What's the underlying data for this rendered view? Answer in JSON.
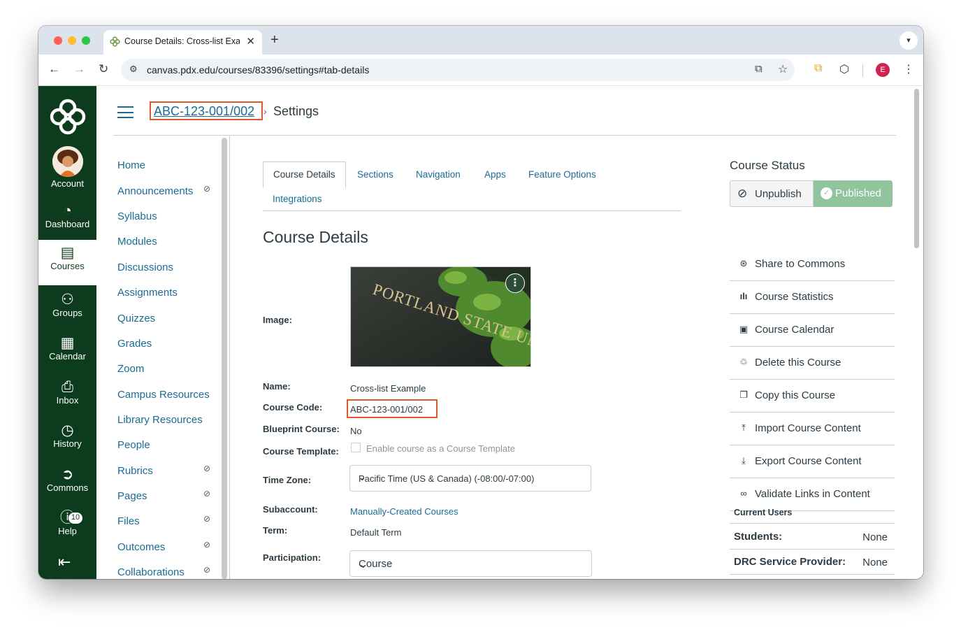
{
  "browser": {
    "tab_title": "Course Details: Cross-list Example",
    "url": "canvas.pdx.edu/courses/83396/settings#tab-details",
    "profile_initial": "E"
  },
  "global_nav": {
    "items": [
      {
        "label": "Account",
        "icon": "avatar-icon"
      },
      {
        "label": "Dashboard",
        "icon": "dashboard-icon"
      },
      {
        "label": "Courses",
        "icon": "courses-icon"
      },
      {
        "label": "Groups",
        "icon": "groups-icon"
      },
      {
        "label": "Calendar",
        "icon": "calendar-icon"
      },
      {
        "label": "Inbox",
        "icon": "inbox-icon"
      },
      {
        "label": "History",
        "icon": "history-icon"
      },
      {
        "label": "Commons",
        "icon": "commons-icon"
      },
      {
        "label": "Help",
        "icon": "help-icon"
      }
    ],
    "help_badge": "10",
    "active": "Courses",
    "brand_color": "#0d3b1d"
  },
  "breadcrumb": {
    "course": "ABC-123-001/002",
    "current": "Settings"
  },
  "course_nav": {
    "items": [
      {
        "label": "Home",
        "hidden": false
      },
      {
        "label": "Announcements",
        "hidden": true
      },
      {
        "label": "Syllabus",
        "hidden": false
      },
      {
        "label": "Modules",
        "hidden": false
      },
      {
        "label": "Discussions",
        "hidden": false
      },
      {
        "label": "Assignments",
        "hidden": false
      },
      {
        "label": "Quizzes",
        "hidden": false
      },
      {
        "label": "Grades",
        "hidden": false
      },
      {
        "label": "Zoom",
        "hidden": false
      },
      {
        "label": "Campus Resources",
        "hidden": false
      },
      {
        "label": "Library Resources",
        "hidden": false
      },
      {
        "label": "People",
        "hidden": false
      },
      {
        "label": "Rubrics",
        "hidden": true
      },
      {
        "label": "Pages",
        "hidden": true
      },
      {
        "label": "Files",
        "hidden": true
      },
      {
        "label": "Outcomes",
        "hidden": true
      },
      {
        "label": "Collaborations",
        "hidden": true
      }
    ]
  },
  "tabs": [
    "Course Details",
    "Sections",
    "Navigation",
    "Apps",
    "Feature Options",
    "Integrations"
  ],
  "details": {
    "title": "Course Details",
    "image_label": "Image:",
    "image_sign_text": "PORTLAND STATE UNIVERSITY",
    "name_label": "Name:",
    "name_value": "Cross-list Example",
    "code_label": "Course Code:",
    "code_value": "ABC-123-001/002",
    "blueprint_label": "Blueprint Course:",
    "blueprint_value": "No",
    "template_label": "Course Template:",
    "template_checkbox": "Enable course as a Course Template",
    "timezone_label": "Time Zone:",
    "timezone_value": "Pacific Time (US & Canada) (-08:00/-07:00)",
    "subaccount_label": "Subaccount:",
    "subaccount_value": "Manually-Created Courses",
    "term_label": "Term:",
    "term_value": "Default Term",
    "participation_label": "Participation:",
    "participation_value": "Course"
  },
  "sidebar": {
    "status_title": "Course Status",
    "unpublish": "Unpublish",
    "published": "Published",
    "published_color": "#8fc49d",
    "actions": [
      {
        "label": "Share to Commons",
        "icon": "share-icon"
      },
      {
        "label": "Course Statistics",
        "icon": "bar-chart-icon"
      },
      {
        "label": "Course Calendar",
        "icon": "calendar-icon"
      },
      {
        "label": "Delete this Course",
        "icon": "trash-icon"
      },
      {
        "label": "Copy this Course",
        "icon": "copy-icon"
      },
      {
        "label": "Import Course Content",
        "icon": "upload-icon"
      },
      {
        "label": "Export Course Content",
        "icon": "download-icon"
      },
      {
        "label": "Validate Links in Content",
        "icon": "link-icon"
      }
    ],
    "current_users_title": "Current Users",
    "users": [
      {
        "label": "Students:",
        "value": "None"
      },
      {
        "label": "DRC Service Provider:",
        "value": "None"
      }
    ]
  },
  "highlight_color": "#e0592a"
}
